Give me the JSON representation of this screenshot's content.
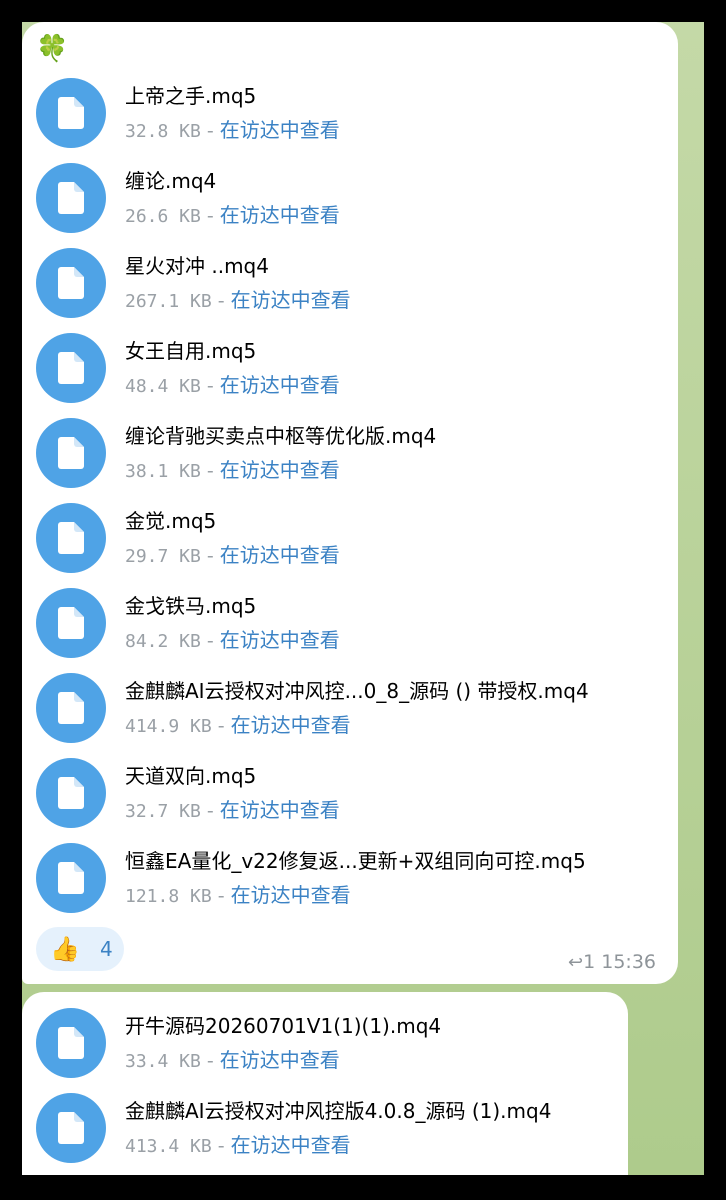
{
  "header": {
    "emoji": "🍀"
  },
  "files_message_1": [
    {
      "name": "上帝之手.mq5",
      "size": "32.8 KB",
      "link": "在访达中查看"
    },
    {
      "name": "缠论.mq4",
      "size": "26.6 KB",
      "link": "在访达中查看"
    },
    {
      "name": "星火对冲 ..mq4",
      "size": "267.1 KB",
      "link": "在访达中查看"
    },
    {
      "name": "女王自用.mq5",
      "size": "48.4 KB",
      "link": "在访达中查看"
    },
    {
      "name": "缠论背驰买卖点中枢等优化版.mq4",
      "size": "38.1 KB",
      "link": "在访达中查看"
    },
    {
      "name": "金觉.mq5",
      "size": "29.7 KB",
      "link": "在访达中查看"
    },
    {
      "name": "金戈铁马.mq5",
      "size": "84.2 KB",
      "link": "在访达中查看"
    },
    {
      "name": "金麒麟AI云授权对冲风控...0_8_源码 () 带授权.mq4",
      "size": "414.9 KB",
      "link": "在访达中查看"
    },
    {
      "name": "天道双向.mq5",
      "size": "32.7 KB",
      "link": "在访达中查看"
    },
    {
      "name": "恒鑫EA量化_v22修复返...更新+双组同向可控.mq5",
      "size": "121.8 KB",
      "link": "在访达中查看"
    }
  ],
  "reaction": {
    "emoji": "👍",
    "count": "4"
  },
  "message_meta": {
    "reply_icon": "↩",
    "replies": "1",
    "time": "15:36"
  },
  "files_message_2": [
    {
      "name": "开牛源码20260701V1(1)(1).mq4",
      "size": "33.4 KB",
      "link": "在访达中查看"
    },
    {
      "name": "金麒麟AI云授权对冲风控版4.0.8_源码 (1).mq4",
      "size": "413.4 KB",
      "link": "在访达中查看"
    }
  ],
  "colors": {
    "file_icon": "#4fa3e6",
    "link": "#3b82c4",
    "meta_gray": "#9aa0a6",
    "reaction_bg": "#e5f1fc",
    "chat_background": "#b9d19a"
  },
  "icons": {
    "file": "document-icon",
    "reply": "reply-arrow-icon"
  }
}
